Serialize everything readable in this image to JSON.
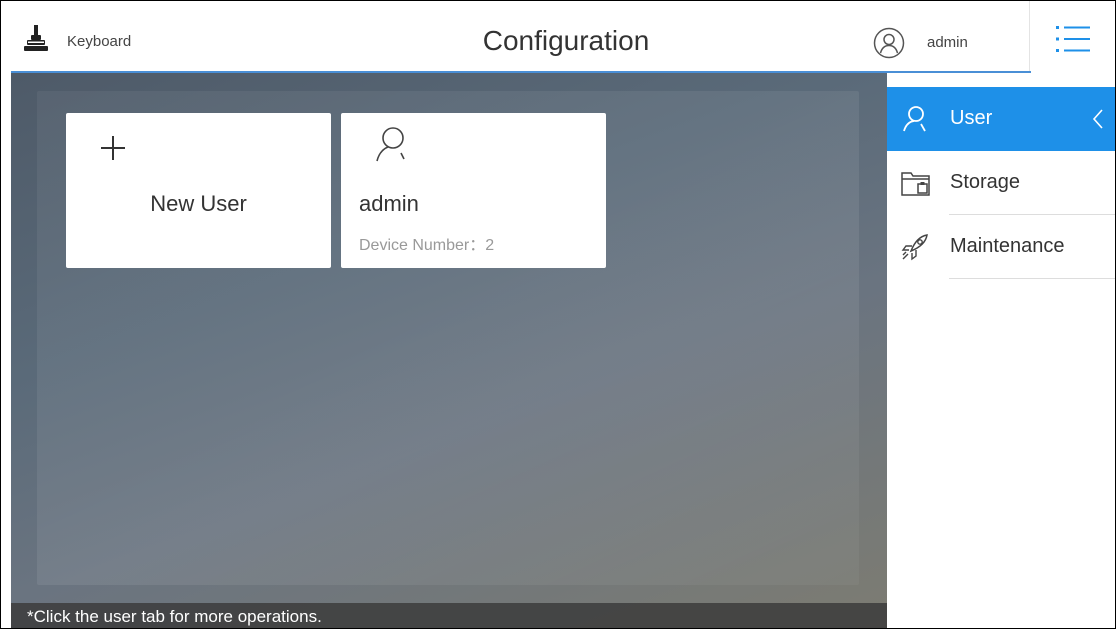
{
  "header": {
    "app_name": "Keyboard",
    "title": "Configuration",
    "username": "admin",
    "app_icon": "joystick-icon",
    "user_icon": "user-circle-icon",
    "menu_icon": "menu-icon"
  },
  "main": {
    "cards": [
      {
        "label": "New User",
        "icon": "plus-icon"
      },
      {
        "name": "admin",
        "subtitle": "Device Number：2",
        "icon": "user-icon"
      }
    ],
    "footer_note": "*Click the user tab for more operations."
  },
  "sidebar": {
    "items": [
      {
        "label": "User",
        "icon": "user-icon",
        "active": true
      },
      {
        "label": "Storage",
        "icon": "storage-icon",
        "active": false
      },
      {
        "label": "Maintenance",
        "icon": "rocket-icon",
        "active": false
      }
    ]
  },
  "colors": {
    "accent": "#1e90e8",
    "header_line": "#4a8fd6",
    "footer_bg": "#3c3c3c"
  }
}
